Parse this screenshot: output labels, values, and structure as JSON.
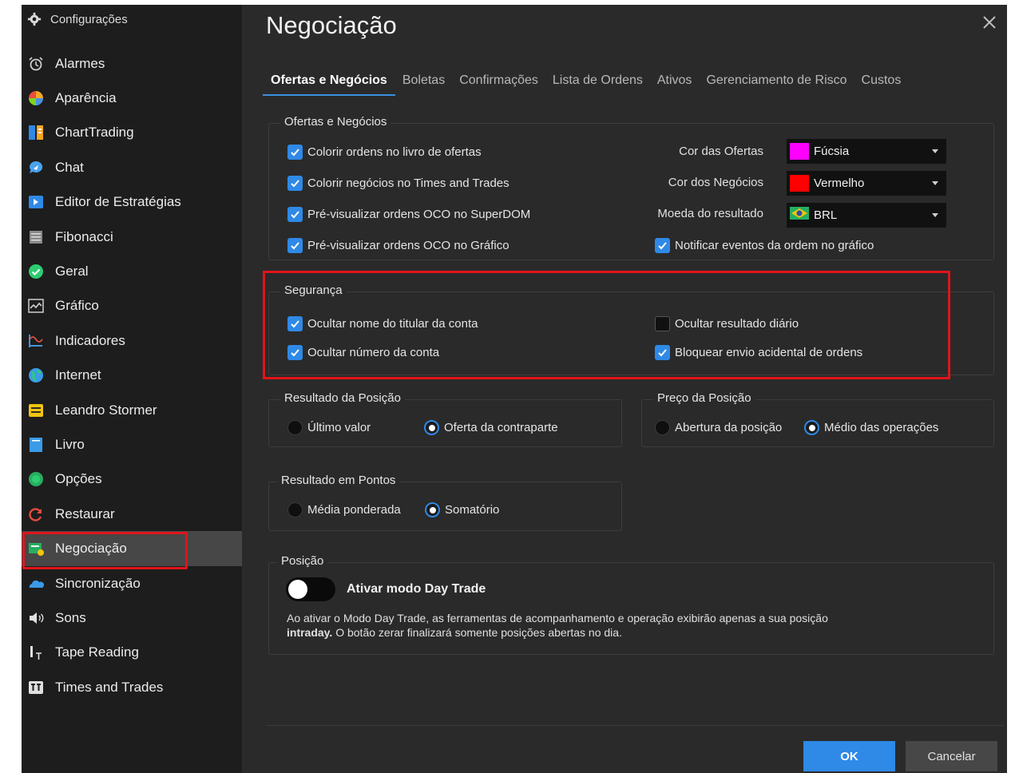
{
  "sidebar": {
    "title": "Configurações",
    "items": [
      {
        "label": "Alarmes",
        "icon": "alarm-clock-icon"
      },
      {
        "label": "Aparência",
        "icon": "color-wheel-icon"
      },
      {
        "label": "ChartTrading",
        "icon": "chart-trading-icon"
      },
      {
        "label": "Chat",
        "icon": "chat-bubble-icon"
      },
      {
        "label": "Editor de Estratégias",
        "icon": "strategy-editor-icon"
      },
      {
        "label": "Fibonacci",
        "icon": "fibonacci-icon"
      },
      {
        "label": "Geral",
        "icon": "check-circle-icon"
      },
      {
        "label": "Gráfico",
        "icon": "line-chart-icon"
      },
      {
        "label": "Indicadores",
        "icon": "indicators-icon"
      },
      {
        "label": "Internet",
        "icon": "globe-icon"
      },
      {
        "label": "Leandro Stormer",
        "icon": "profile-card-icon"
      },
      {
        "label": "Livro",
        "icon": "book-icon"
      },
      {
        "label": "Opções",
        "icon": "options-icon"
      },
      {
        "label": "Restaurar",
        "icon": "restore-icon"
      },
      {
        "label": "Negociação",
        "icon": "trading-icon"
      },
      {
        "label": "Sincronização",
        "icon": "cloud-icon"
      },
      {
        "label": "Sons",
        "icon": "speaker-icon"
      },
      {
        "label": "Tape Reading",
        "icon": "tape-reading-icon"
      },
      {
        "label": "Times and Trades",
        "icon": "times-trades-icon"
      }
    ]
  },
  "main": {
    "title": "Negociação",
    "tabs": [
      "Ofertas e Negócios",
      "Boletas",
      "Confirmações",
      "Lista de Ordens",
      "Ativos",
      "Gerenciamento de Risco",
      "Custos"
    ],
    "ofertas": {
      "legend": "Ofertas e Negócios",
      "checks": [
        {
          "label": "Colorir ordens no livro de ofertas",
          "checked": true
        },
        {
          "label": "Colorir negócios no Times and Trades",
          "checked": true
        },
        {
          "label": "Pré-visualizar ordens OCO no SuperDOM",
          "checked": true
        },
        {
          "label": "Pré-visualizar ordens OCO no Gráfico",
          "checked": true
        }
      ],
      "cor_ofertas_label": "Cor das Ofertas",
      "cor_ofertas_value": "Fúcsia",
      "cor_ofertas_color": "#ff00ff",
      "cor_negocios_label": "Cor dos Negócios",
      "cor_negocios_value": "Vermelho",
      "cor_negocios_color": "#ff0000",
      "moeda_label": "Moeda do resultado",
      "moeda_value": "BRL",
      "notificar_label": "Notificar eventos da ordem no gráfico",
      "notificar_checked": true
    },
    "seguranca": {
      "legend": "Segurança",
      "ocultar_nome": "Ocultar nome do titular da conta",
      "ocultar_numero": "Ocultar número da conta",
      "ocultar_resultado": "Ocultar resultado diário",
      "bloquear_envio": "Bloquear envio acidental de ordens"
    },
    "resultado_posicao": {
      "legend": "Resultado da Posição",
      "opt1": "Último valor",
      "opt2": "Oferta da contraparte",
      "selected": "Oferta da contraparte"
    },
    "preco_posicao": {
      "legend": "Preço da Posição",
      "opt1": "Abertura da posição",
      "opt2": "Médio das operações",
      "selected": "Médio das operações"
    },
    "resultado_pontos": {
      "legend": "Resultado em Pontos",
      "opt1": "Média ponderada",
      "opt2": "Somatório",
      "selected": "Somatório"
    },
    "posicao": {
      "legend": "Posição",
      "toggle_label": "Ativar modo Day Trade",
      "toggle_on": false,
      "desc_line1": "Ao ativar o Modo Day Trade, as ferramentas de acompanhamento e operação exibirão apenas a sua posição",
      "desc_bold": "intraday.",
      "desc_rest": " O botão zerar finalizará somente posições abertas no dia."
    },
    "buttons": {
      "ok": "OK",
      "cancel": "Cancelar"
    }
  },
  "colors": {
    "accent": "#2f89e6",
    "highlight": "#e0141b",
    "background": "#2a2a2a",
    "sidebar": "#1d1d1d"
  }
}
